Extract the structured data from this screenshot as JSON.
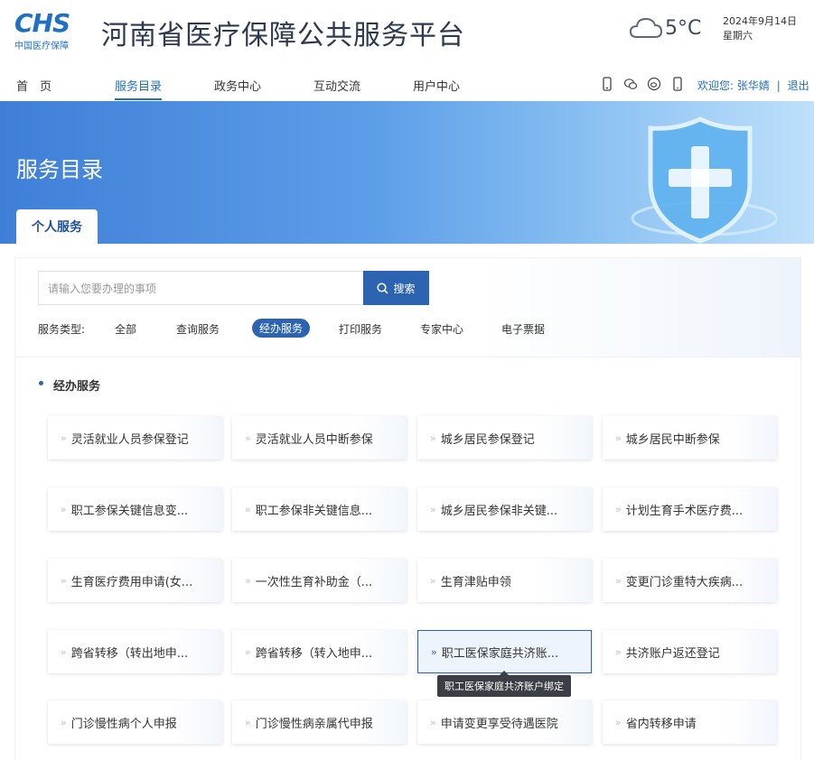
{
  "header": {
    "logo_mark": "CHS",
    "logo_sub": "中国医疗保障",
    "site_title": "河南省医疗保障公共服务平台",
    "weather_icon": "cloud-icon",
    "temperature": "5°C",
    "date": "2024年9月14日",
    "weekday": "星期六"
  },
  "nav": {
    "items": [
      {
        "label": "首　页"
      },
      {
        "label": "服务目录"
      },
      {
        "label": "政务中心"
      },
      {
        "label": "互动交流"
      },
      {
        "label": "用户中心"
      }
    ],
    "active_index": 1,
    "welcome_prefix": "欢迎您:",
    "user_name": "张华婧",
    "separator": "|",
    "logout": "退出"
  },
  "banner": {
    "title": "服务目录",
    "tab_label": "个人服务"
  },
  "search": {
    "placeholder": "请输入您要办理的事项",
    "button_label": "搜索"
  },
  "filters": {
    "label": "服务类型:",
    "items": [
      "全部",
      "查询服务",
      "经办服务",
      "打印服务",
      "专家中心",
      "电子票据"
    ],
    "active": "经办服务"
  },
  "section": {
    "title": "经办服务"
  },
  "cards": [
    "灵活就业人员参保登记",
    "灵活就业人员中断参保",
    "城乡居民参保登记",
    "城乡居民中断参保",
    "职工参保关键信息变...",
    "职工参保非关键信息...",
    "城乡居民参保非关键...",
    "计划生育手术医疗费...",
    "生育医疗费用申请(女...",
    "一次性生育补助金（...",
    "生育津贴申领",
    "变更门诊重特大疾病...",
    "跨省转移（转出地申...",
    "跨省转移（转入地申...",
    "职工医保家庭共济账...",
    "共济账户返还登记",
    "门诊慢性病个人申报",
    "门诊慢性病亲属代申报",
    "申请变更享受待遇医院",
    "省内转移申请"
  ],
  "hovered_card_index": 14,
  "tooltip": "职工医保家庭共济账户绑定",
  "colors": {
    "primary": "#2d64b2",
    "brand": "#1f6fc4",
    "title_text": "#2b3a4f"
  }
}
